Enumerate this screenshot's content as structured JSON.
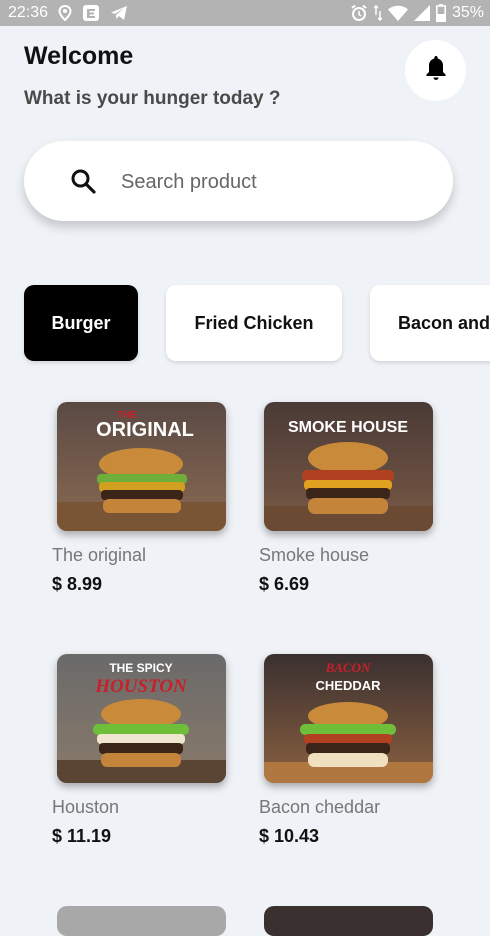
{
  "status_bar": {
    "time": "22:36",
    "battery": "35%",
    "icons": [
      "location-icon",
      "mail-app-icon",
      "telegram-icon",
      "alarm-icon",
      "wifi-icon",
      "signal-icon",
      "battery-icon"
    ]
  },
  "header": {
    "title": "Welcome",
    "subtitle": "What is your hunger today ?",
    "bell_icon": "bell-icon"
  },
  "search": {
    "placeholder": "Search product",
    "icon": "search-icon"
  },
  "categories": [
    {
      "label": "Burger",
      "active": true
    },
    {
      "label": "Fried Chicken",
      "active": false
    },
    {
      "label": "Bacon and",
      "active": false
    }
  ],
  "products": [
    {
      "name": "The original",
      "price": "$ 8.99",
      "brand_top": "THE",
      "brand": "ORIGINAL"
    },
    {
      "name": "Smoke house",
      "price": "$ 6.69",
      "brand": "SMOKE HOUSE"
    },
    {
      "name": "Houston",
      "price": "$ 11.19",
      "brand_top": "THE SPICY",
      "brand": "HOUSTON"
    },
    {
      "name": "Bacon cheddar",
      "price": "$ 10.43",
      "brand_top": "BACON",
      "brand": "CHEDDAR"
    }
  ],
  "colors": {
    "background": "#eff2f6",
    "active_category": "#000000",
    "status_bar": "#b3b3b3"
  }
}
